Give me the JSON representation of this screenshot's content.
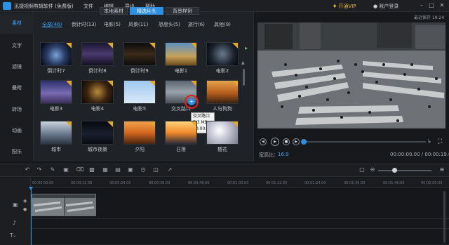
{
  "titlebar": {
    "app_title": "迅捷视频剪辑软件 (免费版)",
    "menus": [
      "文件",
      "编辑",
      "导出",
      "帮助"
    ],
    "vip_label": "开通VIP",
    "account_label": "账户登录",
    "window_buttons": [
      "minimize-icon",
      "maximize-icon",
      "close-icon"
    ]
  },
  "sidebar": {
    "items": [
      {
        "label": "素材",
        "active": true
      },
      {
        "label": "文字",
        "active": false
      },
      {
        "label": "滤镜",
        "active": false
      },
      {
        "label": "叠附",
        "active": false
      },
      {
        "label": "转场",
        "active": false
      },
      {
        "label": "动画",
        "active": false
      },
      {
        "label": "配乐",
        "active": false
      }
    ]
  },
  "library": {
    "tabs": [
      {
        "label": "本地素材",
        "active": false
      },
      {
        "label": "精选片头",
        "active": true
      },
      {
        "label": "背景样例",
        "active": false
      }
    ],
    "categories": [
      "全部(46)",
      "倒计时(13)",
      "电影(5)",
      "风景(11)",
      "恐度头(5)",
      "旅行(6)",
      "其他(9)"
    ],
    "thumbnails": [
      {
        "label": "倒计时7"
      },
      {
        "label": "倒计时8"
      },
      {
        "label": "倒计时9"
      },
      {
        "label": "电影1"
      },
      {
        "label": "电影2"
      },
      {
        "label": "电影3"
      },
      {
        "label": "电影4"
      },
      {
        "label": "电影5"
      },
      {
        "label": "交叉路口"
      },
      {
        "label": "人与狗狗"
      },
      {
        "label": "城市"
      },
      {
        "label": "城市夜景"
      },
      {
        "label": "夕阳"
      },
      {
        "label": "日落"
      },
      {
        "label": "樱花"
      }
    ],
    "tooltip": {
      "name": "交叉路口",
      "size": "7.3 MB",
      "duration": "00:00:19"
    }
  },
  "preview": {
    "autosave": "最近保存 19:24",
    "ratio_label": "宽高比：",
    "ratio_value": "16:9",
    "timecode": "00:00:00.00 / 00:00:19.80",
    "progress": 0.0
  },
  "timeline": {
    "ticks": [
      "00:00:00.00",
      "00:00:12.00",
      "00:00:24.00",
      "00:00:36.00",
      "00:00:48.00",
      "00:01:00.00",
      "00:01:12.00",
      "00:01:24.00",
      "00:01:36.00",
      "00:01:48.00",
      "00:02:00.00"
    ],
    "zoom": 0.27
  },
  "colors": {
    "accent": "#2f8fe0",
    "vip": "#e9b73c",
    "badge": "#e3a92a"
  }
}
